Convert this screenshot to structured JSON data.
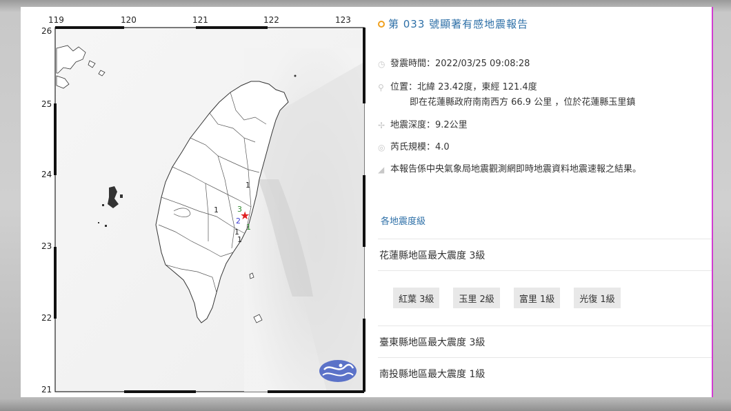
{
  "map": {
    "lon_labels": [
      "119",
      "120",
      "121",
      "122",
      "123"
    ],
    "lat_labels": [
      "26",
      "25",
      "24",
      "23",
      "22",
      "21"
    ],
    "epicenter_symbol": "★",
    "intensity_marks": [
      {
        "text": "1",
        "color": "#222222"
      },
      {
        "text": "3",
        "color": "#2e8b2e"
      },
      {
        "text": "2",
        "color": "#3a3ad0"
      },
      {
        "text": "1",
        "color": "#222222"
      },
      {
        "text": "1",
        "color": "#222222"
      },
      {
        "text": "1",
        "color": "#222222"
      },
      {
        "text": "1",
        "color": "#222222"
      }
    ],
    "logo": "cwb-logo"
  },
  "report": {
    "title": "第 033 號顯著有感地震報告",
    "time_label": "發震時間：2022/03/25 09:08:28",
    "location_label": "位置：北緯 23.42度，東經 121.4度",
    "location_detail": "即在花蓮縣政府南南西方 66.9 公里 ，位於花蓮縣玉里鎮",
    "depth_label": "地震深度：9.2公里",
    "magnitude_label": "芮氏規模：4.0",
    "note": "本報告係中央氣象局地震觀測網即時地震資料地震速報之結果。",
    "icons": [
      "clock-icon",
      "location-pin-icon",
      "depth-star-icon",
      "magnitude-wave-icon",
      "megaphone-icon"
    ]
  },
  "intensity": {
    "section_title": "各地震度級",
    "regions": [
      {
        "label": "花蓮縣地區最大震度 3級"
      },
      {
        "label": "臺東縣地區最大震度 3級"
      },
      {
        "label": "南投縣地區最大震度 1級"
      }
    ],
    "hualien_stations": [
      "紅葉 3級",
      "玉里 2級",
      "富里 1級",
      "光復 1級"
    ]
  },
  "colors": {
    "accent": "#2d6fa7",
    "title_dot": "#f0a01e",
    "epicenter": "#e02020",
    "card_border": "#d23cd2"
  }
}
